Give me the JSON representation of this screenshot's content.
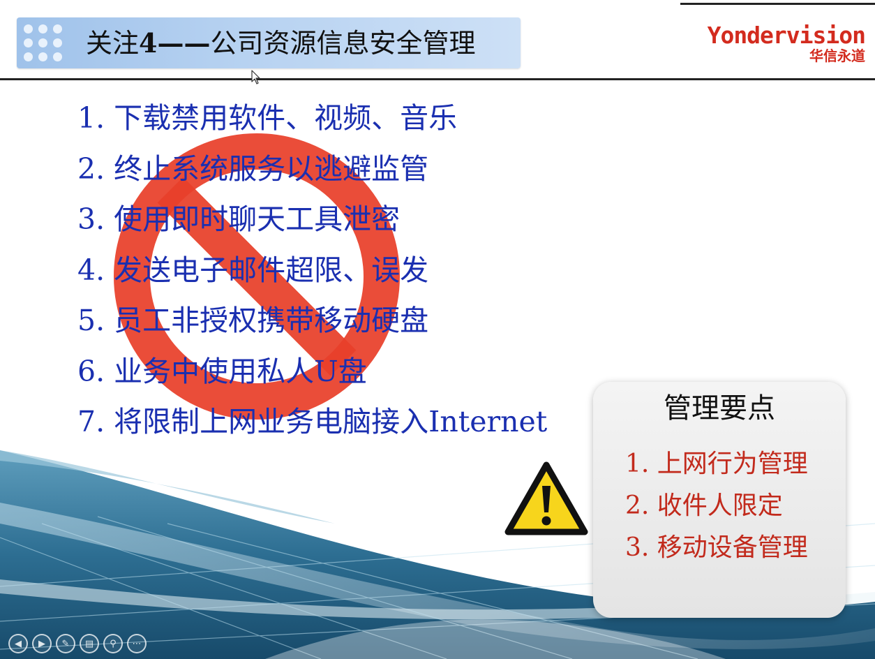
{
  "header": {
    "title_prefix": "关注",
    "title_bold": "4——",
    "title_suffix": "公司资源信息安全管理",
    "logo_en": "Yondervision",
    "logo_cn": "华信永道"
  },
  "main_list": [
    "1. 下载禁用软件、视频、音乐",
    "2. 终止系统服务以逃避监管",
    "3. 使用即时聊天工具泄密",
    "4. 发送电子邮件超限、误发",
    "5. 员工非授权携带移动硬盘",
    "6. 业务中使用私人U盘",
    "7. 将限制上网业务电脑接入Internet"
  ],
  "key_points": {
    "title": "管理要点",
    "items": [
      "1. 上网行为管理",
      "2. 收件人限定",
      "3. 移动设备管理"
    ]
  },
  "icons": {
    "forbidden": "prohibited-sign-icon",
    "warning": "warning-triangle-icon",
    "controls": [
      "previous-icon",
      "next-icon",
      "pen-icon",
      "slides-icon",
      "zoom-icon",
      "more-icon"
    ]
  },
  "colors": {
    "list_text": "#1a2fb0",
    "key_points_text": "#c22a1c",
    "forbidden_red": "#e8402a",
    "warning_yellow": "#f7d51c",
    "logo_red": "#d32b1e"
  }
}
